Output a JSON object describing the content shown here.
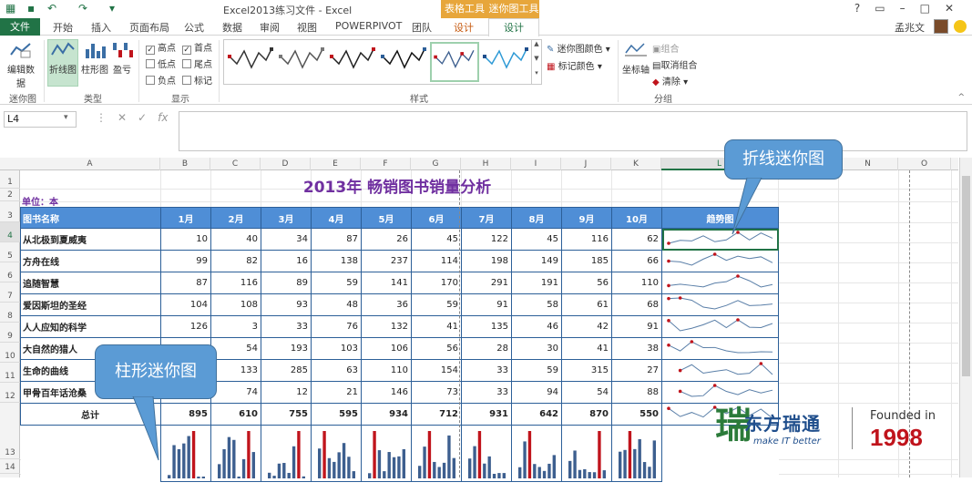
{
  "window": {
    "title": "Excel2013练习文件 - Excel",
    "context_groups": [
      {
        "label": "表格工具",
        "color": "#e7a63b"
      },
      {
        "label": "迷你图工具",
        "color": "#e7a63b"
      }
    ],
    "help": "?",
    "user": "孟兆文"
  },
  "tabs": {
    "file": "文件",
    "items": [
      "开始",
      "插入",
      "页面布局",
      "公式",
      "数据",
      "审阅",
      "视图",
      "POWERPIVOT",
      "团队",
      "设计"
    ],
    "active": "设计"
  },
  "ribbon": {
    "edit_data": "编辑数据",
    "group_sparkline": "迷你图",
    "type_line": "折线图",
    "type_column": "柱形图",
    "type_winloss": "盈亏",
    "group_type": "类型",
    "show": {
      "high": "高点",
      "low": "低点",
      "negative": "负点",
      "first": "首点",
      "last": "尾点",
      "markers": "标记"
    },
    "show_checked": {
      "high": true,
      "low": false,
      "negative": false,
      "first": true,
      "last": false,
      "markers": false
    },
    "group_show": "显示",
    "group_style": "样式",
    "sparkline_color": "迷你图颜色",
    "marker_color": "标记颜色",
    "axis": "坐标轴",
    "group_btn": "组合",
    "ungroup_btn": "取消组合",
    "clear_btn": "清除",
    "group_group": "分组"
  },
  "formula_bar": {
    "namebox": "L4",
    "fx": "fx",
    "value": ""
  },
  "sheet": {
    "columns": [
      "A",
      "B",
      "C",
      "D",
      "E",
      "F",
      "G",
      "H",
      "I",
      "J",
      "K",
      "L",
      "M",
      "N",
      "O",
      "P"
    ],
    "rows": [
      "1",
      "2",
      "3",
      "4",
      "5",
      "6",
      "7",
      "8",
      "9",
      "10",
      "11",
      "12",
      "13",
      "14"
    ],
    "selected_col": "L",
    "selected_row": "4",
    "title": "2013年 畅销图书销量分析",
    "unit": "单位：本",
    "headers": [
      "图书名称",
      "1月",
      "2月",
      "3月",
      "4月",
      "5月",
      "6月",
      "7月",
      "8月",
      "9月",
      "10月",
      "趋势图"
    ],
    "books": [
      {
        "name": "从北极到夏威夷",
        "values": [
          10,
          40,
          34,
          87,
          26,
          45,
          122,
          45,
          116,
          62
        ]
      },
      {
        "name": "方舟在线",
        "values": [
          99,
          82,
          16,
          138,
          237,
          114,
          198,
          149,
          185,
          66
        ]
      },
      {
        "name": "追随智慧",
        "values": [
          87,
          116,
          89,
          59,
          141,
          170,
          291,
          191,
          56,
          110
        ]
      },
      {
        "name": "爱因斯坦的圣经",
        "values": [
          104,
          108,
          93,
          48,
          36,
          59,
          91,
          58,
          61,
          68
        ]
      },
      {
        "name": "人人应知的科学",
        "values": [
          126,
          3,
          33,
          76,
          132,
          41,
          135,
          46,
          42,
          91
        ]
      },
      {
        "name": "大自然的猎人",
        "values": [
          141,
          54,
          193,
          103,
          106,
          56,
          28,
          30,
          41,
          38
        ]
      },
      {
        "name": "生命的曲线",
        "values": [
          null,
          133,
          285,
          63,
          110,
          154,
          33,
          59,
          315,
          27
        ]
      },
      {
        "name": "甲骨百年话沧桑",
        "values": [
          null,
          74,
          12,
          21,
          146,
          73,
          33,
          94,
          54,
          88
        ]
      }
    ],
    "total_label": "总计",
    "totals": [
      895,
      610,
      755,
      595,
      934,
      712,
      931,
      642,
      870,
      550
    ]
  },
  "callouts": {
    "line": "折线迷你图",
    "column": "柱形迷你图"
  },
  "logo": {
    "mark": "瑞",
    "name": "东方瑞通",
    "tagline": "make IT better",
    "founded": "Founded in",
    "year": "1998"
  },
  "colors": {
    "excel_green": "#217346",
    "header_blue": "#4f8ed6",
    "title_purple": "#7030a0",
    "column_bar": "#3d5f8f",
    "high_bar": "#c0141c",
    "line_spark": "#5a7fa8",
    "marker_red": "#c0141c"
  }
}
